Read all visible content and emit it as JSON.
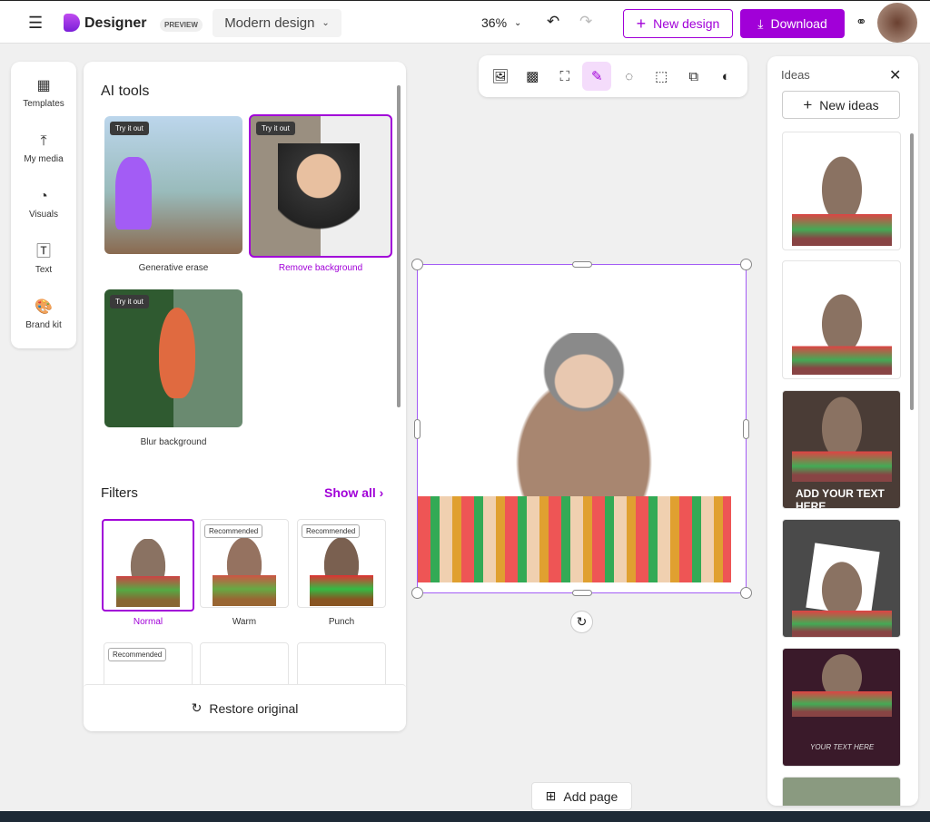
{
  "header": {
    "app_name": "Designer",
    "badge": "PREVIEW",
    "design_name": "Modern design",
    "zoom": "36%",
    "new_design": "New design",
    "download": "Download"
  },
  "rail": [
    {
      "label": "Templates",
      "icon": "grid-icon"
    },
    {
      "label": "My media",
      "icon": "upload-icon"
    },
    {
      "label": "Visuals",
      "icon": "shapes-icon"
    },
    {
      "label": "Text",
      "icon": "text-icon"
    },
    {
      "label": "Brand kit",
      "icon": "palette-icon"
    }
  ],
  "panel": {
    "ai_title": "AI tools",
    "try": "Try it out",
    "tools": [
      "Generative erase",
      "Remove background",
      "Blur background"
    ],
    "filters_title": "Filters",
    "show_all": "Show all",
    "recommended": "Recommended",
    "filters": [
      "Normal",
      "Warm",
      "Punch"
    ],
    "restore": "Restore original"
  },
  "ideas": {
    "title": "Ideas",
    "new_ideas": "New ideas",
    "text1": "ADD YOUR TEXT HERE",
    "text2": "YOUR TEXT HERE"
  },
  "canvas": {
    "add_page": "Add page"
  },
  "colors": {
    "accent": "#a100d8"
  }
}
